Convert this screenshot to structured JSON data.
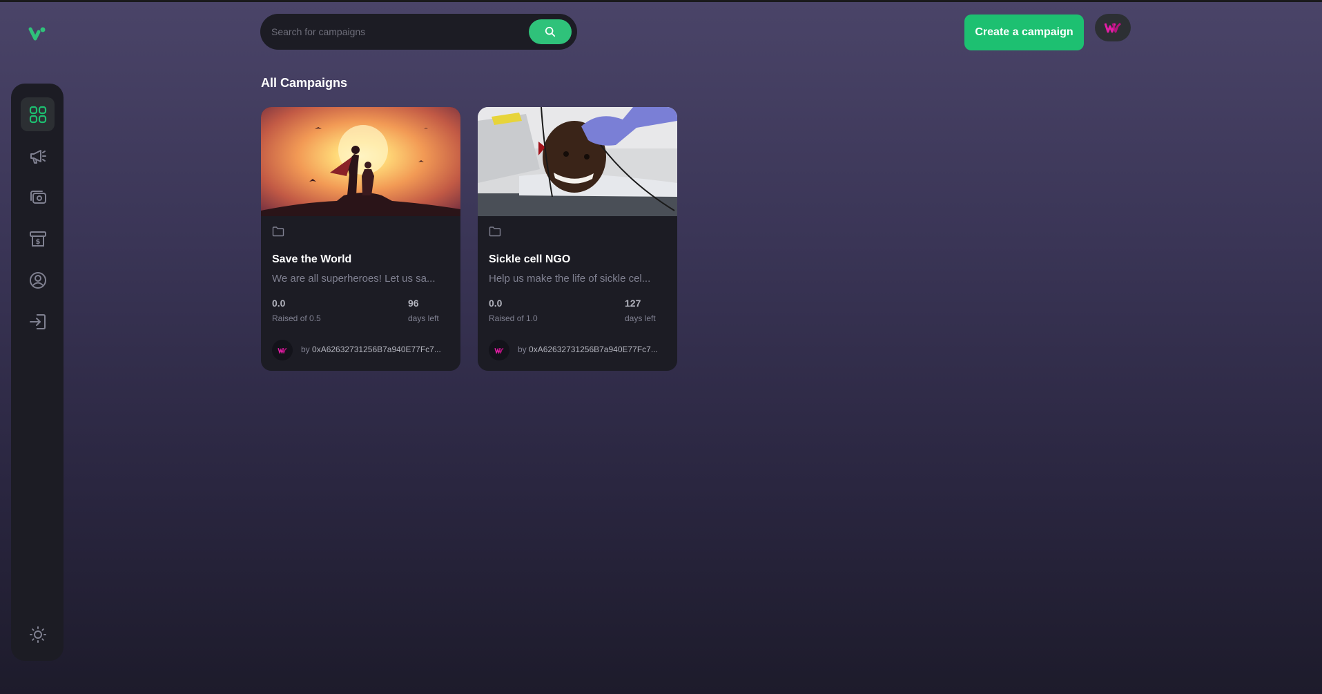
{
  "search": {
    "placeholder": "Search for campaigns"
  },
  "header": {
    "create_label": "Create a campaign"
  },
  "section": {
    "title": "All Campaigns"
  },
  "colors": {
    "accent": "#1dc071",
    "card_bg": "#1c1c24",
    "muted": "#808191"
  },
  "sidebar": {
    "items": [
      {
        "icon": "dashboard-icon",
        "active": true
      },
      {
        "icon": "campaign-icon",
        "active": false
      },
      {
        "icon": "payment-icon",
        "active": false
      },
      {
        "icon": "withdraw-icon",
        "active": false
      },
      {
        "icon": "profile-icon",
        "active": false
      },
      {
        "icon": "logout-icon",
        "active": false
      }
    ],
    "theme_icon": "sun-icon"
  },
  "campaigns": [
    {
      "title": "Save the World",
      "description": "We are all superheroes! Let us sa...",
      "raised": "0.0",
      "raised_label": "Raised of 0.5",
      "days": "96",
      "days_label": "days left",
      "by": "by",
      "owner": "0xA62632731256B7a940E77Fc7..."
    },
    {
      "title": "Sickle cell NGO",
      "description": "Help us make the life of sickle cel...",
      "raised": "0.0",
      "raised_label": "Raised of 1.0",
      "days": "127",
      "days_label": "days left",
      "by": "by",
      "owner": "0xA62632731256B7a940E77Fc7..."
    }
  ]
}
